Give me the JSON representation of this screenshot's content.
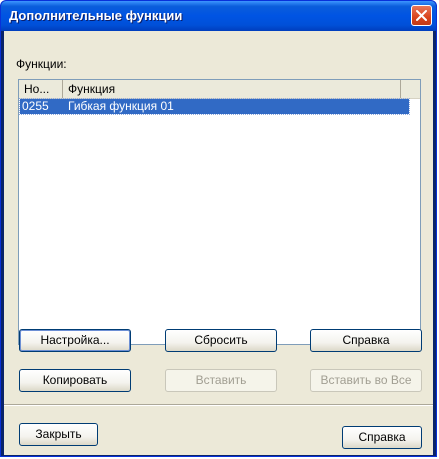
{
  "window": {
    "title": "Дополнительные функции"
  },
  "functions_label": "Функции:",
  "list": {
    "columns": [
      "Но...",
      "Функция"
    ],
    "rows": [
      {
        "number": "0255",
        "name": "Гибкая функция 01",
        "selected": true
      }
    ]
  },
  "buttons": {
    "settings": "Настройка...",
    "reset": "Сбросить",
    "help_top": "Справка",
    "copy": "Копировать",
    "paste": "Вставить",
    "paste_all": "Вставить во Все",
    "close": "Закрыть",
    "help_bottom": "Справка"
  },
  "disabled": [
    "paste",
    "paste_all"
  ],
  "colors": {
    "titlebar": "#0054e3",
    "selection": "#316ac5",
    "dialog_bg": "#ece9d8",
    "close_button": "#d9441c"
  },
  "icons": {
    "close": "close-icon"
  }
}
